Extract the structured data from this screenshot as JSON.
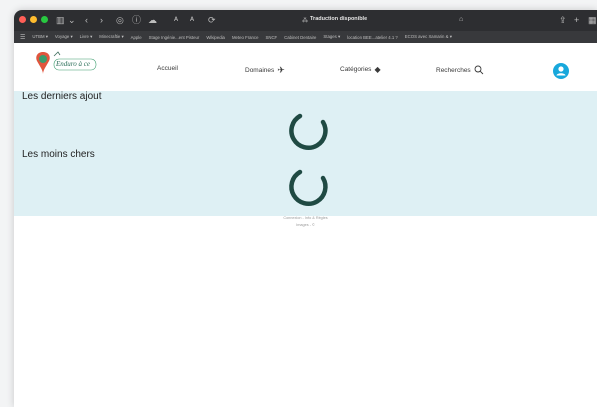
{
  "browser": {
    "tab_title": "Traduction disponible",
    "bookmarks": [
      "UTBM ▾",
      "Voyage ▾",
      "Livre ▾",
      "Minecraftie ▾",
      "Apple",
      "Stage Ingénie...ent Pisteur",
      "Wikipedia",
      "Meteo France",
      "SNCF",
      "Cabinet Dentaire",
      "Stages ▾",
      "location BEE...atelier 4.1 ?",
      "ECOS avec Xamarin & ▾"
    ]
  },
  "site": {
    "logo_text": "Enduro à ce",
    "nav": {
      "accueil": "Accueil",
      "domaines": "Domaines",
      "categories": "Catégories",
      "recherches": "Recherches"
    },
    "sections": {
      "latest": "Les derniers ajout",
      "cheapest": "Les moins chers"
    },
    "footer": {
      "line1": "Connexion - Info & Règles",
      "line2": "Images - ©"
    }
  },
  "colors": {
    "hero_bg": "#def0f4",
    "spinner": "#1f4a43",
    "avatar": "#18a8dc",
    "chrome": "#2d2e31"
  }
}
